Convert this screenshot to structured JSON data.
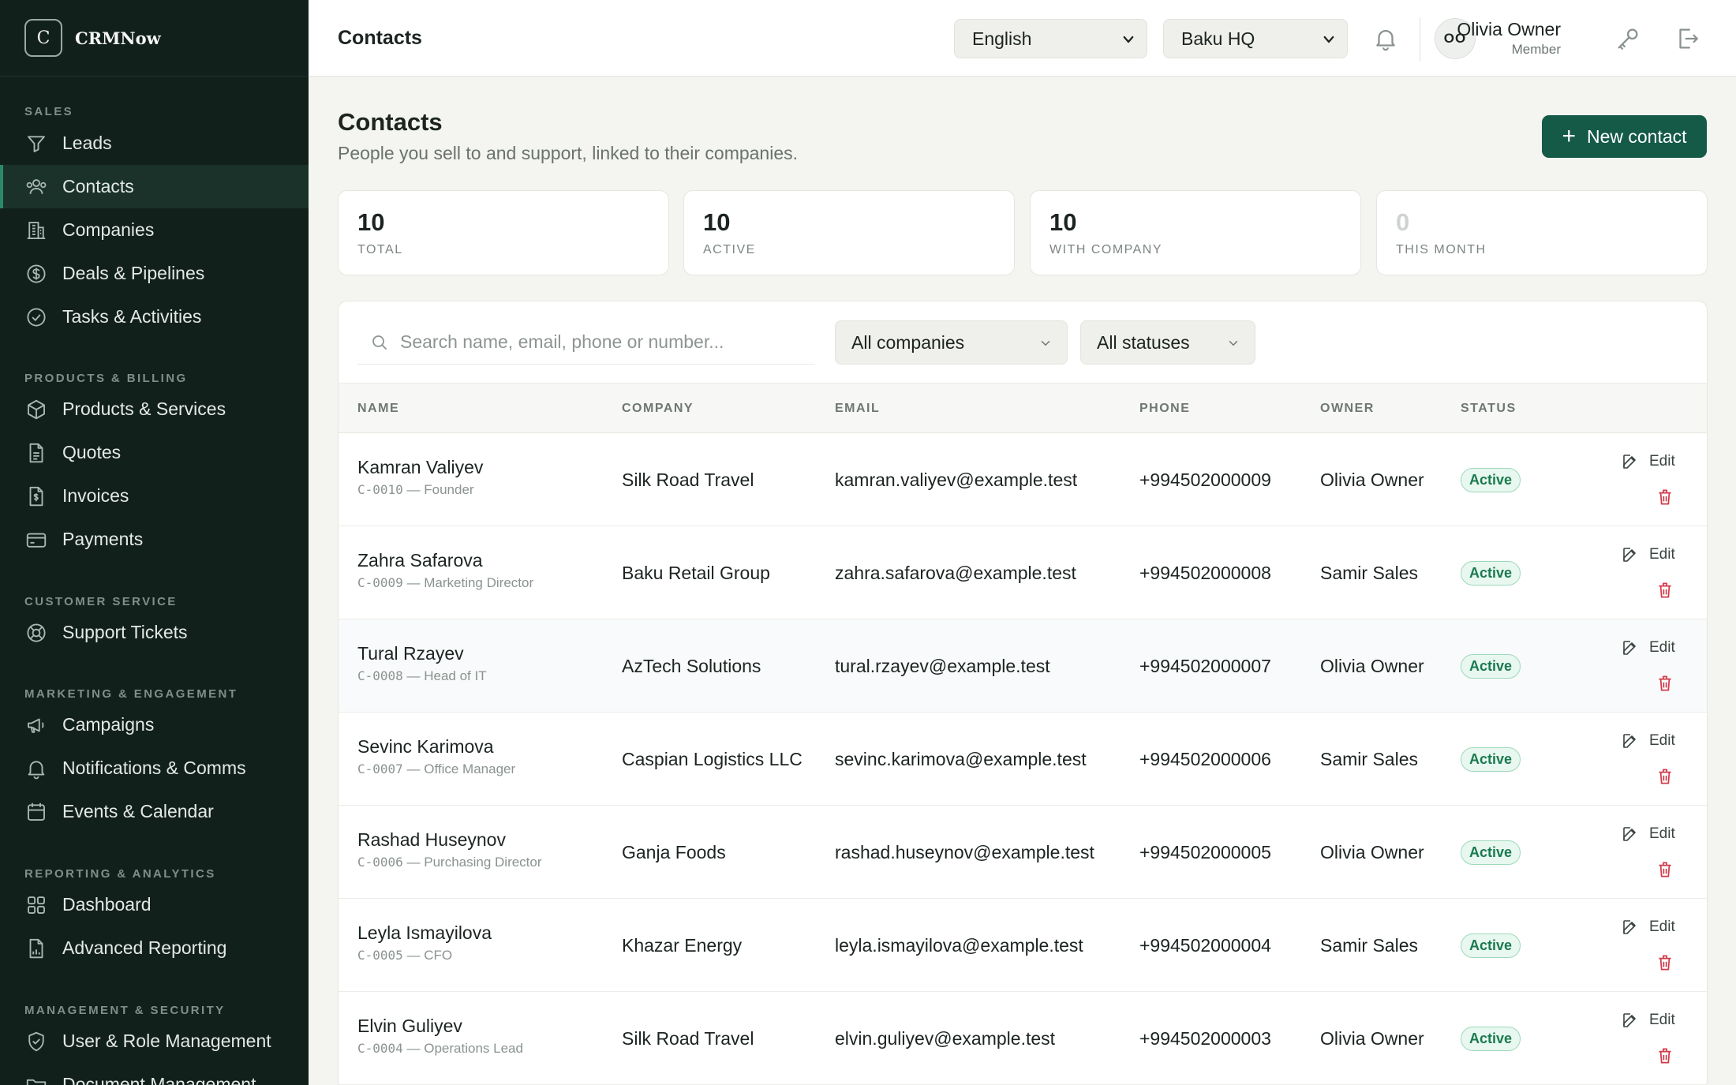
{
  "brand": {
    "logo_letter": "C",
    "name": "CRMNow"
  },
  "sidebar": {
    "sections": [
      {
        "title": "SALES",
        "items": [
          {
            "label": "Leads",
            "icon": "funnel-icon"
          },
          {
            "label": "Contacts",
            "icon": "users-icon",
            "active": true
          },
          {
            "label": "Companies",
            "icon": "building-icon"
          },
          {
            "label": "Deals & Pipelines",
            "icon": "dollar-circle-icon"
          },
          {
            "label": "Tasks & Activities",
            "icon": "check-circle-icon"
          }
        ]
      },
      {
        "title": "PRODUCTS & BILLING",
        "items": [
          {
            "label": "Products & Services",
            "icon": "box-icon"
          },
          {
            "label": "Quotes",
            "icon": "document-icon"
          },
          {
            "label": "Invoices",
            "icon": "invoice-dollar-icon"
          },
          {
            "label": "Payments",
            "icon": "credit-card-icon"
          }
        ]
      },
      {
        "title": "CUSTOMER SERVICE",
        "items": [
          {
            "label": "Support Tickets",
            "icon": "lifebuoy-icon"
          }
        ]
      },
      {
        "title": "MARKETING & ENGAGEMENT",
        "items": [
          {
            "label": "Campaigns",
            "icon": "megaphone-icon"
          },
          {
            "label": "Notifications & Comms",
            "icon": "bell-icon"
          },
          {
            "label": "Events & Calendar",
            "icon": "calendar-icon"
          }
        ]
      },
      {
        "title": "REPORTING & ANALYTICS",
        "items": [
          {
            "label": "Dashboard",
            "icon": "grid-icon"
          },
          {
            "label": "Advanced Reporting",
            "icon": "report-chart-icon"
          }
        ]
      },
      {
        "title": "MANAGEMENT & SECURITY",
        "items": [
          {
            "label": "User & Role Management",
            "icon": "shield-check-icon"
          },
          {
            "label": "Document Management",
            "icon": "folder-icon"
          }
        ]
      }
    ]
  },
  "topbar": {
    "title": "Contacts",
    "language": "English",
    "branch": "Baku HQ",
    "user": {
      "initials": "OO",
      "name": "Olivia Owner",
      "role": "Member"
    }
  },
  "page": {
    "title": "Contacts",
    "subtitle": "People you sell to and support, linked to their companies.",
    "new_button": "New contact"
  },
  "stats": [
    {
      "value": "10",
      "label": "TOTAL"
    },
    {
      "value": "10",
      "label": "ACTIVE"
    },
    {
      "value": "10",
      "label": "WITH COMPANY"
    },
    {
      "value": "0",
      "label": "THIS MONTH"
    }
  ],
  "filters": {
    "search_placeholder": "Search name, email, phone or number...",
    "company": "All companies",
    "status": "All statuses"
  },
  "table": {
    "headers": {
      "name": "NAME",
      "company": "COMPANY",
      "email": "EMAIL",
      "phone": "PHONE",
      "owner": "OWNER",
      "status": "STATUS"
    },
    "edit_label": "Edit",
    "rows": [
      {
        "name": "Kamran Valiyev",
        "code": "C-0010",
        "title": "Founder",
        "company": "Silk Road Travel",
        "email": "kamran.valiyev@example.test",
        "phone": "+994502000009",
        "owner": "Olivia Owner",
        "status": "Active"
      },
      {
        "name": "Zahra Safarova",
        "code": "C-0009",
        "title": "Marketing Director",
        "company": "Baku Retail Group",
        "email": "zahra.safarova@example.test",
        "phone": "+994502000008",
        "owner": "Samir Sales",
        "status": "Active"
      },
      {
        "name": "Tural Rzayev",
        "code": "C-0008",
        "title": "Head of IT",
        "company": "AzTech Solutions",
        "email": "tural.rzayev@example.test",
        "phone": "+994502000007",
        "owner": "Olivia Owner",
        "status": "Active"
      },
      {
        "name": "Sevinc Karimova",
        "code": "C-0007",
        "title": "Office Manager",
        "company": "Caspian Logistics LLC",
        "email": "sevinc.karimova@example.test",
        "phone": "+994502000006",
        "owner": "Samir Sales",
        "status": "Active"
      },
      {
        "name": "Rashad Huseynov",
        "code": "C-0006",
        "title": "Purchasing Director",
        "company": "Ganja Foods",
        "email": "rashad.huseynov@example.test",
        "phone": "+994502000005",
        "owner": "Olivia Owner",
        "status": "Active"
      },
      {
        "name": "Leyla Ismayilova",
        "code": "C-0005",
        "title": "CFO",
        "company": "Khazar Energy",
        "email": "leyla.ismayilova@example.test",
        "phone": "+994502000004",
        "owner": "Samir Sales",
        "status": "Active"
      },
      {
        "name": "Elvin Guliyev",
        "code": "C-0004",
        "title": "Operations Lead",
        "company": "Silk Road Travel",
        "email": "elvin.guliyev@example.test",
        "phone": "+994502000003",
        "owner": "Olivia Owner",
        "status": "Active"
      }
    ]
  },
  "colors": {
    "sidebar_bg": "#12201c",
    "accent": "#145a47",
    "status_active": "#1a7a4f",
    "delete": "#d23a4a"
  }
}
